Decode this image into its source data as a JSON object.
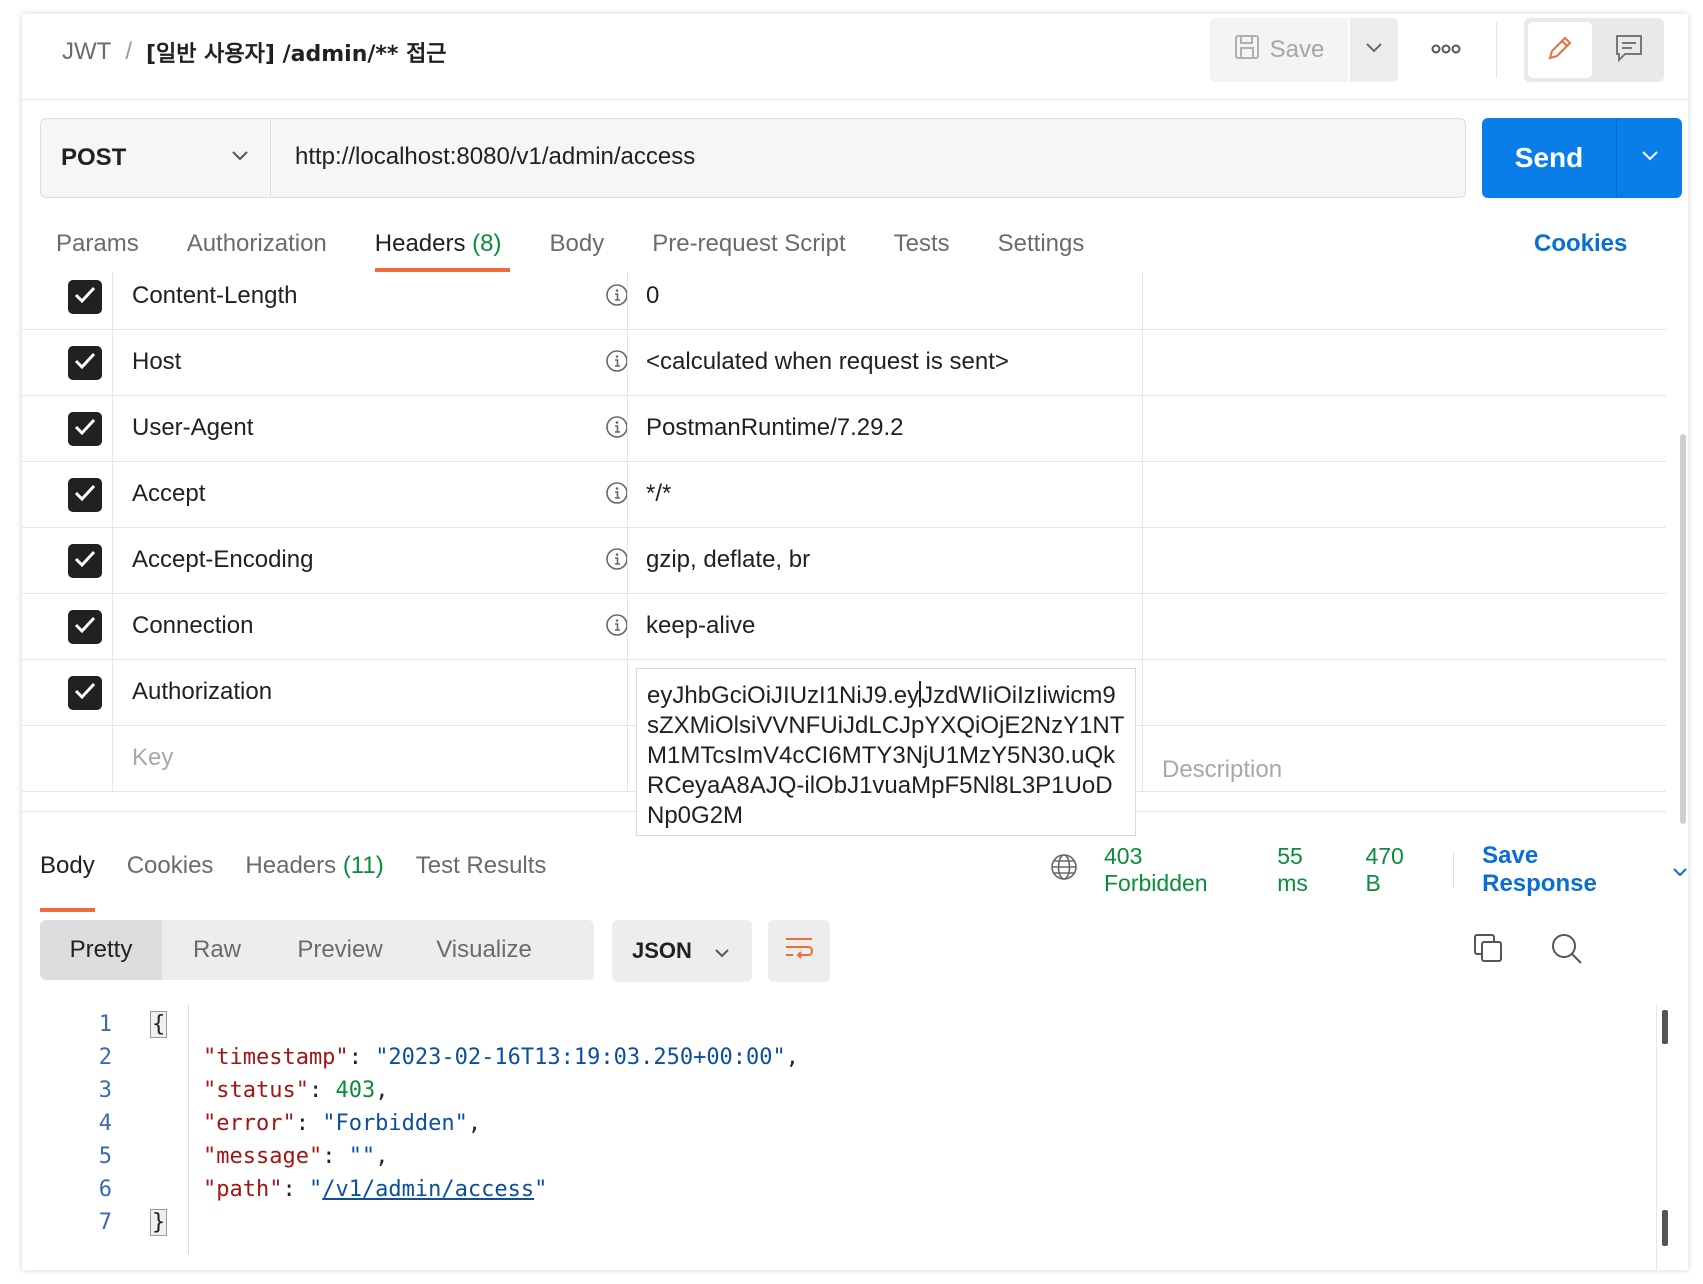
{
  "header": {
    "breadcrumb_parent": "JWT",
    "breadcrumb_sep": "/",
    "title": "[일반 사용자] /admin/** 접근",
    "save_label": "Save"
  },
  "request": {
    "method": "POST",
    "url": "http://localhost:8080/v1/admin/access",
    "send_label": "Send"
  },
  "request_tabs": [
    {
      "label": "Params",
      "count": ""
    },
    {
      "label": "Authorization",
      "count": ""
    },
    {
      "label": "Headers",
      "count": "(8)"
    },
    {
      "label": "Body",
      "count": ""
    },
    {
      "label": "Pre-request Script",
      "count": ""
    },
    {
      "label": "Tests",
      "count": ""
    },
    {
      "label": "Settings",
      "count": ""
    }
  ],
  "cookies_link": "Cookies",
  "headers": [
    {
      "key": "Content-Length",
      "value": "0"
    },
    {
      "key": "Host",
      "value": "<calculated when request is sent>"
    },
    {
      "key": "User-Agent",
      "value": "PostmanRuntime/7.29.2"
    },
    {
      "key": "Accept",
      "value": "*/*"
    },
    {
      "key": "Accept-Encoding",
      "value": "gzip, deflate, br"
    },
    {
      "key": "Connection",
      "value": "keep-alive"
    },
    {
      "key": "Authorization",
      "value": ""
    }
  ],
  "auth_value_before_cursor": "eyJhbGciOiJIUzI1NiJ9.ey",
  "auth_value_after_cursor": "JzdWIiOiIzIiwicm9sZXMiOlsiVVNFUiJdLCJpYXQiOjE2NzY1NTM1MTcsImV4cCI6MTY3NjU1MzY5N30.uQkRCeyaA8AJQ-ilObJ1vuaMpF5Nl8L3P1UoDNp0G2M",
  "new_row": {
    "key_placeholder": "Key",
    "description_placeholder": "Description"
  },
  "response_tabs": [
    {
      "label": "Body",
      "count": ""
    },
    {
      "label": "Cookies",
      "count": ""
    },
    {
      "label": "Headers",
      "count": "(11)"
    },
    {
      "label": "Test Results",
      "count": ""
    }
  ],
  "response_meta": {
    "status": "403 Forbidden",
    "time": "55 ms",
    "size": "470 B",
    "save_response": "Save Response"
  },
  "body_formats": [
    "Pretty",
    "Raw",
    "Preview",
    "Visualize"
  ],
  "body_language": "JSON",
  "code_lines": [
    {
      "n": "1",
      "parts": [
        [
          "brace",
          "{"
        ]
      ]
    },
    {
      "n": "2",
      "parts": [
        [
          "k",
          "    \"timestamp\""
        ],
        [
          "p",
          ": "
        ],
        [
          "s",
          "\"2023-02-16T13:19:03.250+00:00\""
        ],
        [
          "p",
          ","
        ]
      ]
    },
    {
      "n": "3",
      "parts": [
        [
          "k",
          "    \"status\""
        ],
        [
          "p",
          ": "
        ],
        [
          "n",
          "403"
        ],
        [
          "p",
          ","
        ]
      ]
    },
    {
      "n": "4",
      "parts": [
        [
          "k",
          "    \"error\""
        ],
        [
          "p",
          ": "
        ],
        [
          "s",
          "\"Forbidden\""
        ],
        [
          "p",
          ","
        ]
      ]
    },
    {
      "n": "5",
      "parts": [
        [
          "k",
          "    \"message\""
        ],
        [
          "p",
          ": "
        ],
        [
          "s",
          "\"\""
        ],
        [
          "p",
          ","
        ]
      ]
    },
    {
      "n": "6",
      "parts": [
        [
          "k",
          "    \"path\""
        ],
        [
          "p",
          ": "
        ],
        [
          "s",
          "\""
        ],
        [
          "lnk",
          "/v1/admin/access"
        ],
        [
          "s",
          "\""
        ]
      ]
    },
    {
      "n": "7",
      "parts": [
        [
          "brace",
          "}"
        ]
      ]
    }
  ],
  "colors": {
    "accent": "#f26b3a",
    "send": "#0a7ee8",
    "status_ok_green": "#0b8c3c",
    "link_blue": "#0a6fd1"
  }
}
